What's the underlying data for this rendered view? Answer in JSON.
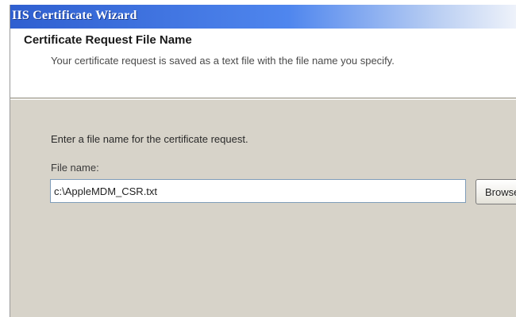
{
  "window": {
    "title": "IIS Certificate Wizard"
  },
  "header": {
    "heading": "Certificate Request File Name",
    "description": "Your certificate request is saved as a text file with the file name you specify."
  },
  "form": {
    "prompt": "Enter a file name for the certificate request.",
    "file_name_label": "File name:",
    "file_name_value": "c:\\AppleMDM_CSR.txt",
    "browse_label": "Browse..."
  }
}
